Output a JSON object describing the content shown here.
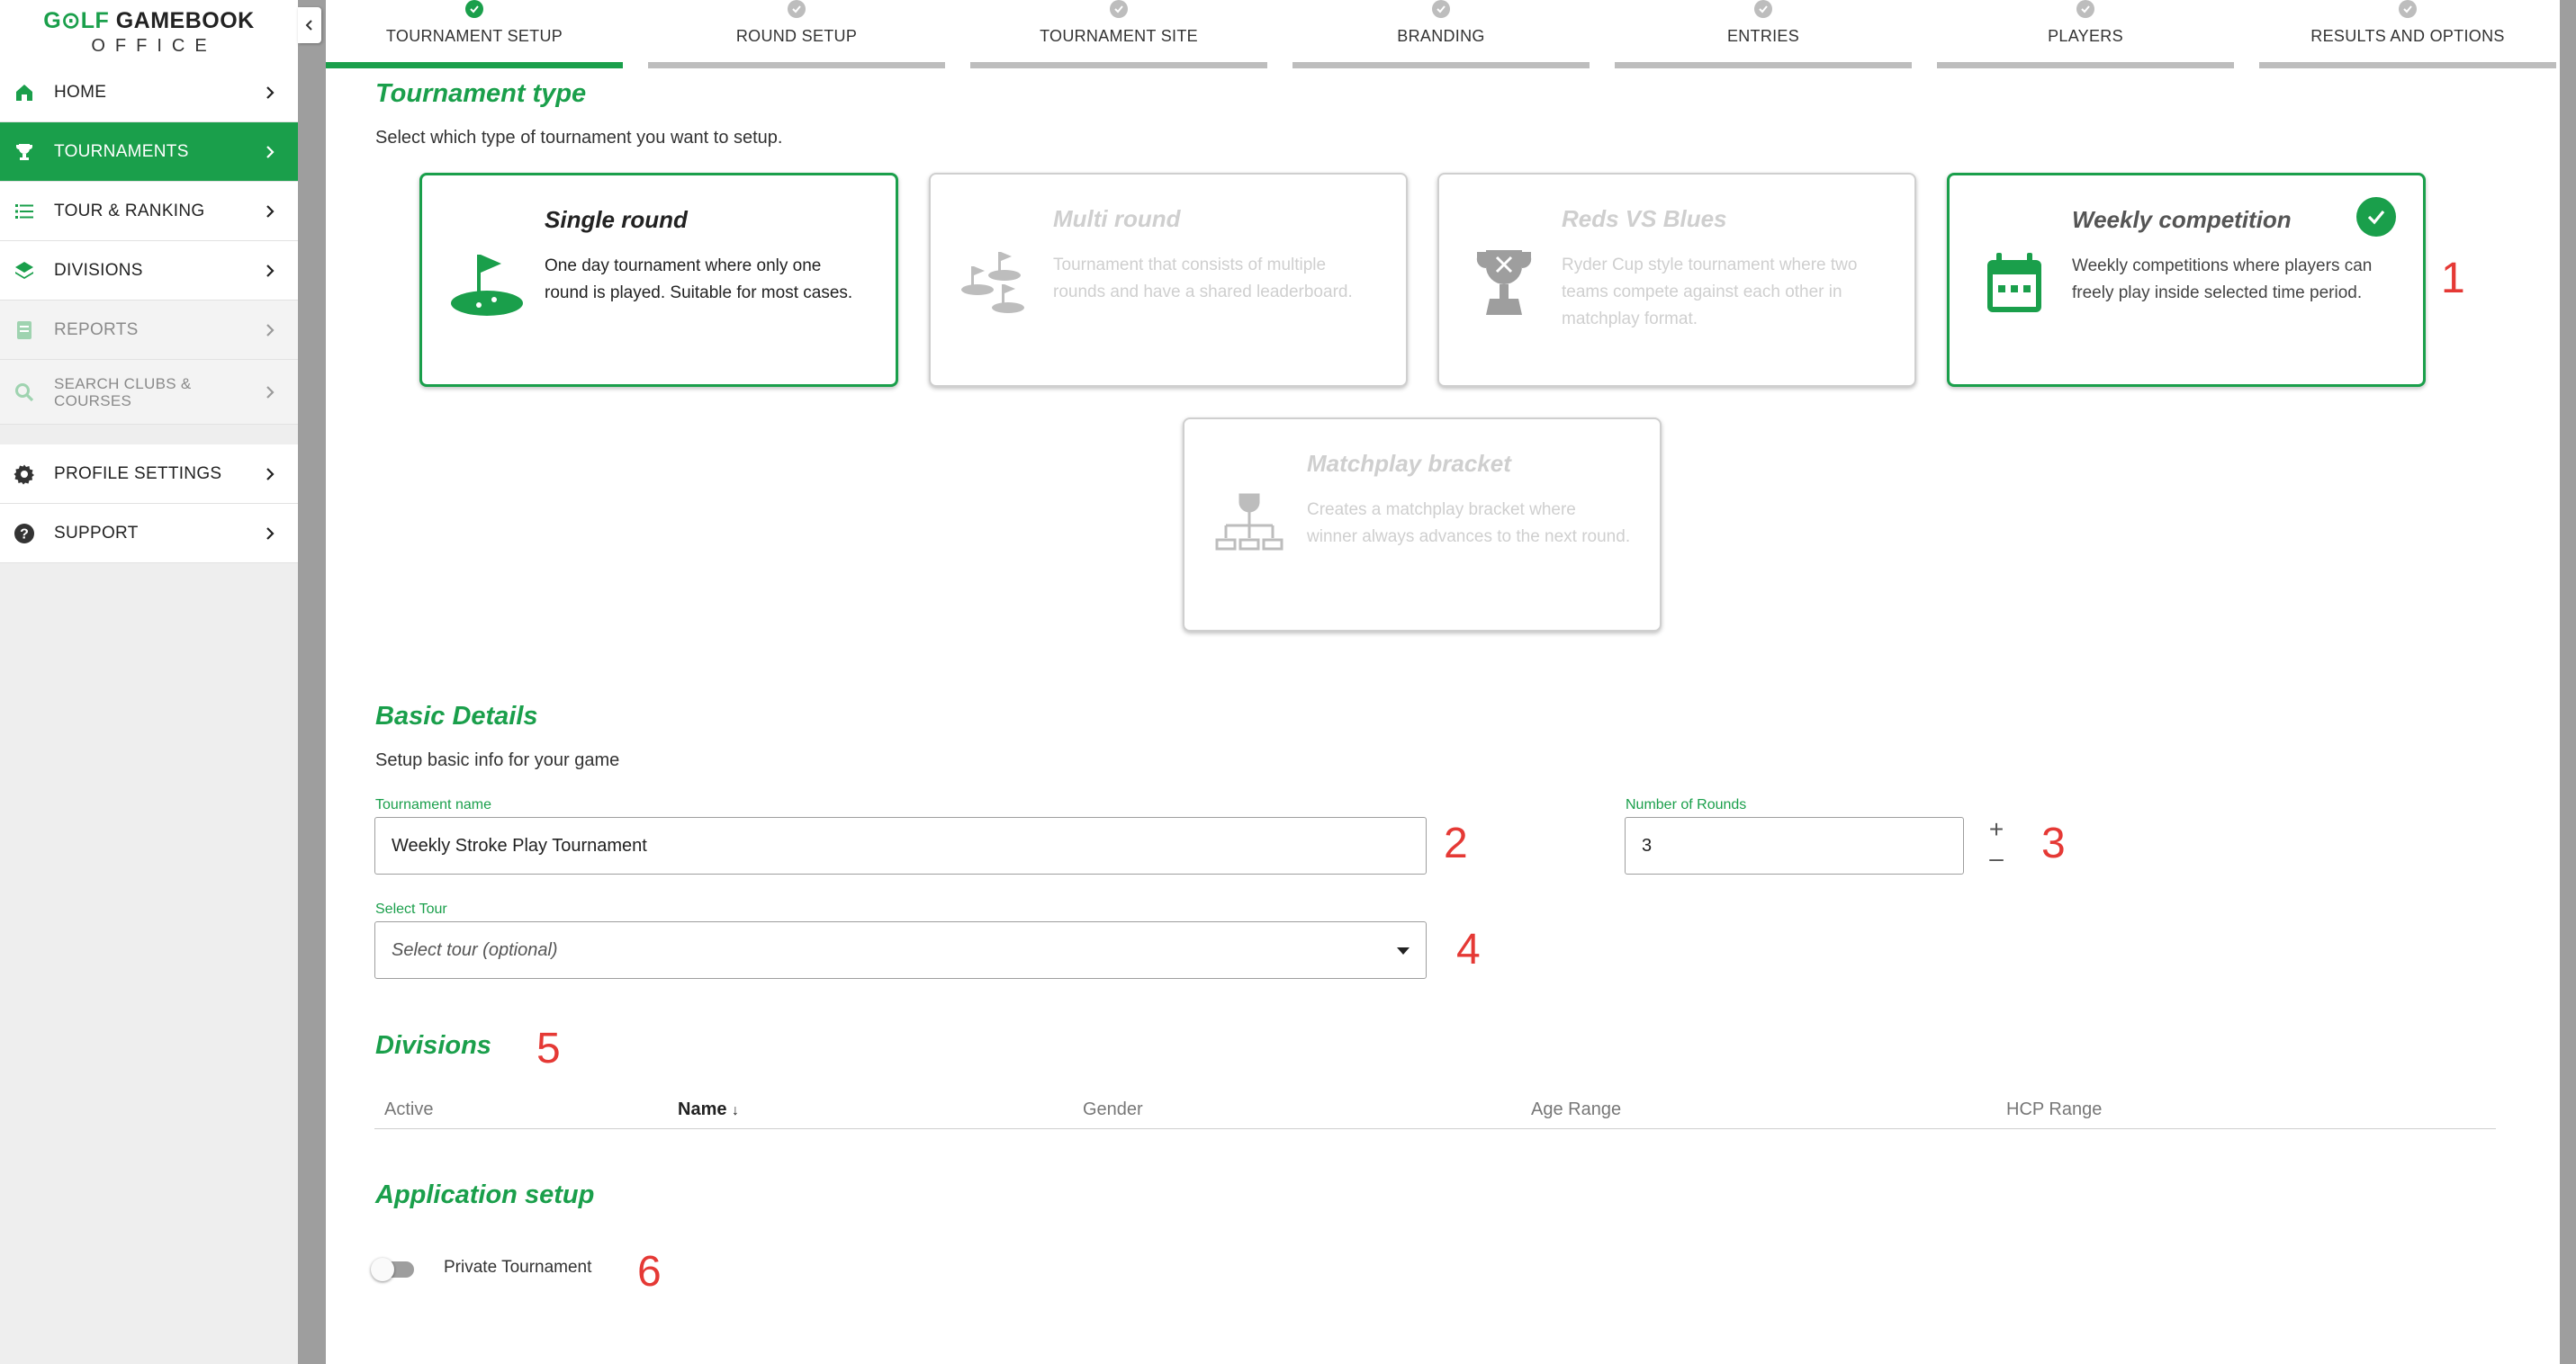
{
  "logo": {
    "top_prefix": "G",
    "top_o": "⊙",
    "top_mid": "LF ",
    "top_suffix": "GAMEBOOK",
    "bottom": "OFFICE"
  },
  "sidebar": {
    "items": [
      {
        "label": "HOME",
        "icon": "home-icon"
      },
      {
        "label": "TOURNAMENTS",
        "icon": "trophy-icon"
      },
      {
        "label": "TOUR & RANKING",
        "icon": "list-icon"
      },
      {
        "label": "DIVISIONS",
        "icon": "layers-icon"
      },
      {
        "label": "REPORTS",
        "icon": "report-icon"
      },
      {
        "label": "SEARCH CLUBS & COURSES",
        "icon": "search-icon"
      },
      {
        "label": "PROFILE SETTINGS",
        "icon": "gear-icon"
      },
      {
        "label": "SUPPORT",
        "icon": "help-icon"
      }
    ]
  },
  "stepper": {
    "steps": [
      {
        "label": "TOURNAMENT SETUP"
      },
      {
        "label": "ROUND SETUP"
      },
      {
        "label": "TOURNAMENT SITE"
      },
      {
        "label": "BRANDING"
      },
      {
        "label": "ENTRIES"
      },
      {
        "label": "PLAYERS"
      },
      {
        "label": "RESULTS AND OPTIONS"
      }
    ],
    "active_index": 0
  },
  "tournament_type": {
    "title": "Tournament type",
    "subtitle": "Select which type of tournament you want to setup.",
    "cards": [
      {
        "title": "Single round",
        "desc": "One day tournament where only one round is played. Suitable for most cases.",
        "icon": "golf-flag-icon",
        "state": "selected"
      },
      {
        "title": "Multi round",
        "desc": "Tournament that consists of multiple rounds and have a shared leaderboard.",
        "icon": "multi-flag-icon",
        "state": "disabled"
      },
      {
        "title": "Reds VS Blues",
        "desc": "Ryder Cup style tournament where two teams compete against each other in matchplay format.",
        "icon": "cup-icon",
        "state": "disabled"
      },
      {
        "title": "Weekly competition",
        "desc": "Weekly competitions where players can freely play inside selected time period.",
        "icon": "calendar-icon",
        "state": "checked"
      },
      {
        "title": "Matchplay bracket",
        "desc": "Creates a matchplay bracket where winner always advances to the next round.",
        "icon": "bracket-icon",
        "state": "disabled"
      }
    ]
  },
  "basic_details": {
    "title": "Basic Details",
    "subtitle": "Setup basic info for your game",
    "name_label": "Tournament name",
    "name_value": "Weekly Stroke Play Tournament",
    "rounds_label": "Number of Rounds",
    "rounds_value": "3",
    "plus": "+",
    "minus": "–",
    "tour_label": "Select Tour",
    "tour_placeholder": "Select tour (optional)"
  },
  "divisions": {
    "title": "Divisions",
    "columns": [
      "Active",
      "Name",
      "Gender",
      "Age Range",
      "HCP Range"
    ],
    "sort_arrow": "↓"
  },
  "application_setup": {
    "title": "Application setup",
    "private_label": "Private Tournament",
    "private_on": false
  },
  "annotations": [
    "1",
    "2",
    "3",
    "4",
    "5",
    "6"
  ],
  "colors": {
    "brand_green": "#1a9f4b",
    "annotation_red": "#e53935",
    "disabled_text": "#cfcfcf"
  }
}
